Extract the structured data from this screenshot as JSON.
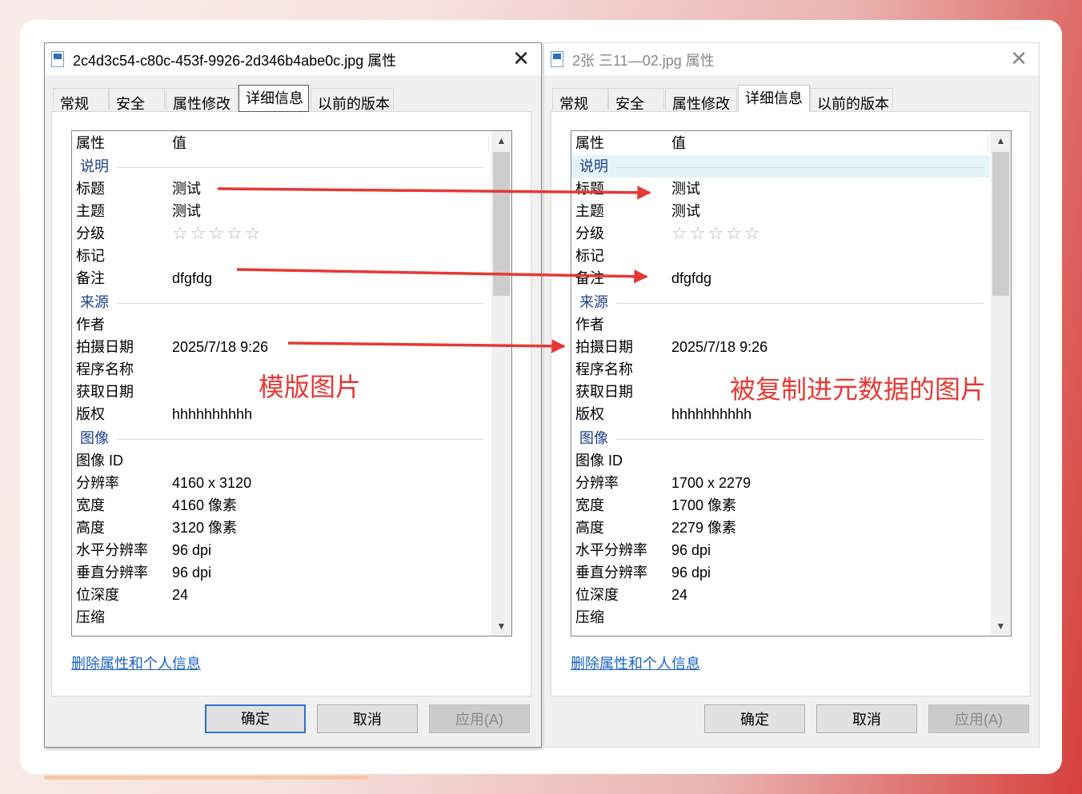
{
  "left_window": {
    "title": "2c4d3c54-c80c-453f-9926-2d346b4abe0c.jpg 属性",
    "close": "✕",
    "tabs": [
      "常规",
      "安全",
      "属性修改",
      "详细信息",
      "以前的版本"
    ],
    "header": {
      "property": "属性",
      "value": "值"
    },
    "groups": {
      "description": "说明",
      "origin": "来源",
      "image": "图像"
    },
    "rows": {
      "title": {
        "k": "标题",
        "v": "测试"
      },
      "subject": {
        "k": "主题",
        "v": "测试"
      },
      "rating": {
        "k": "分级",
        "v": "☆☆☆☆☆"
      },
      "tags": {
        "k": "标记",
        "v": ""
      },
      "comments": {
        "k": "备注",
        "v": "dfgfdg"
      },
      "author": {
        "k": "作者",
        "v": ""
      },
      "date_taken": {
        "k": "拍摄日期",
        "v": "2025/7/18 9:26"
      },
      "program": {
        "k": "程序名称",
        "v": ""
      },
      "date_acquired": {
        "k": "获取日期",
        "v": ""
      },
      "copyright": {
        "k": "版权",
        "v": "hhhhhhhhhh"
      },
      "image_id": {
        "k": "图像 ID",
        "v": ""
      },
      "dimensions": {
        "k": "分辨率",
        "v": "4160 x 3120"
      },
      "width": {
        "k": "宽度",
        "v": "4160 像素"
      },
      "height": {
        "k": "高度",
        "v": "3120 像素"
      },
      "hres": {
        "k": "水平分辨率",
        "v": "96 dpi"
      },
      "vres": {
        "k": "垂直分辨率",
        "v": "96 dpi"
      },
      "bitdepth": {
        "k": "位深度",
        "v": "24"
      },
      "compression": {
        "k": "压缩",
        "v": ""
      }
    },
    "remove_link": "删除属性和个人信息",
    "buttons": {
      "ok": "确定",
      "cancel": "取消",
      "apply": "应用(A)"
    },
    "annotation": "模版图片"
  },
  "right_window": {
    "title": "2张 三11—02.jpg 属性",
    "close": "✕",
    "tabs": [
      "常规",
      "安全",
      "属性修改",
      "详细信息",
      "以前的版本"
    ],
    "header": {
      "property": "属性",
      "value": "值"
    },
    "groups": {
      "description": "说明",
      "origin": "来源",
      "image": "图像"
    },
    "rows": {
      "title": {
        "k": "标题",
        "v": "测试"
      },
      "subject": {
        "k": "主题",
        "v": "测试"
      },
      "rating": {
        "k": "分级",
        "v": "☆☆☆☆☆"
      },
      "tags": {
        "k": "标记",
        "v": ""
      },
      "comments": {
        "k": "备注",
        "v": "dfgfdg"
      },
      "author": {
        "k": "作者",
        "v": ""
      },
      "date_taken": {
        "k": "拍摄日期",
        "v": "2025/7/18 9:26"
      },
      "program": {
        "k": "程序名称",
        "v": ""
      },
      "date_acquired": {
        "k": "获取日期",
        "v": ""
      },
      "copyright": {
        "k": "版权",
        "v": "hhhhhhhhhh"
      },
      "image_id": {
        "k": "图像 ID",
        "v": ""
      },
      "dimensions": {
        "k": "分辨率",
        "v": "1700 x 2279"
      },
      "width": {
        "k": "宽度",
        "v": "1700 像素"
      },
      "height": {
        "k": "高度",
        "v": "2279 像素"
      },
      "hres": {
        "k": "水平分辨率",
        "v": "96 dpi"
      },
      "vres": {
        "k": "垂直分辨率",
        "v": "96 dpi"
      },
      "bitdepth": {
        "k": "位深度",
        "v": "24"
      },
      "compression": {
        "k": "压缩",
        "v": ""
      }
    },
    "remove_link": "删除属性和个人信息",
    "buttons": {
      "ok": "确定",
      "cancel": "取消",
      "apply": "应用(A)"
    },
    "annotation": "被复制进元数据的图片"
  },
  "colors": {
    "annotation": "#e53935",
    "link": "#1a62c4",
    "group_label": "#1e3f8a",
    "accent_button": "#2b74c8"
  }
}
